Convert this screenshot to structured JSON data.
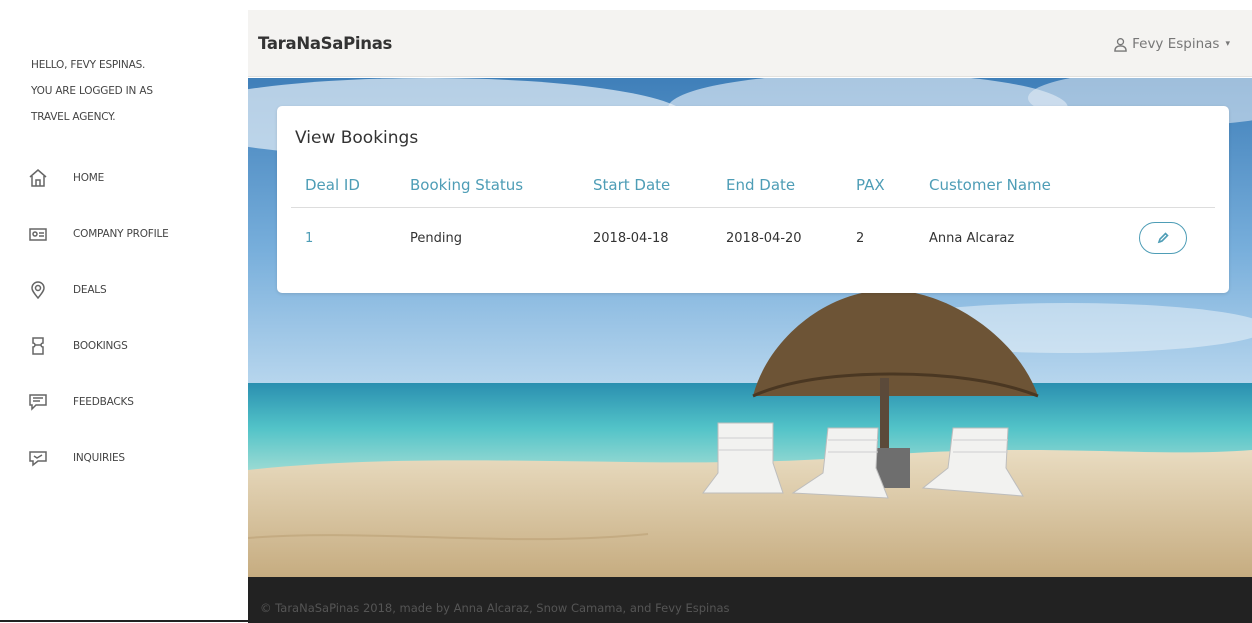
{
  "sidebar": {
    "greeting": [
      "HELLO, FEVY ESPINAS.",
      "YOU ARE LOGGED IN AS",
      "TRAVEL AGENCY."
    ],
    "items": [
      {
        "label": "HOME",
        "icon": "home-icon"
      },
      {
        "label": "COMPANY PROFILE",
        "icon": "id-card-icon"
      },
      {
        "label": "DEALS",
        "icon": "map-pin-icon"
      },
      {
        "label": "BOOKINGS",
        "icon": "ticket-icon"
      },
      {
        "label": "FEEDBACKS",
        "icon": "chat-bubble-icon"
      },
      {
        "label": "INQUIRIES",
        "icon": "question-chat-icon"
      }
    ]
  },
  "navbar": {
    "brand": "TaraNaSaPinas",
    "user_name": "Fevy Espinas",
    "caret": "▾"
  },
  "card": {
    "title": "View Bookings",
    "columns": [
      "Deal ID",
      "Booking Status",
      "Start Date",
      "End Date",
      "PAX",
      "Customer Name"
    ],
    "rows": [
      {
        "deal_id": "1",
        "status": "Pending",
        "start": "2018-04-18",
        "end": "2018-04-20",
        "pax": "2",
        "customer": "Anna Alcaraz"
      }
    ]
  },
  "footer": {
    "text": "© TaraNaSaPinas 2018, made by Anna Alcaraz, Snow Camama, and Fevy Espinas"
  },
  "colors": {
    "accent": "#4e9db6",
    "navbar_bg": "#f4f3f1",
    "footer_bg": "#222222"
  }
}
